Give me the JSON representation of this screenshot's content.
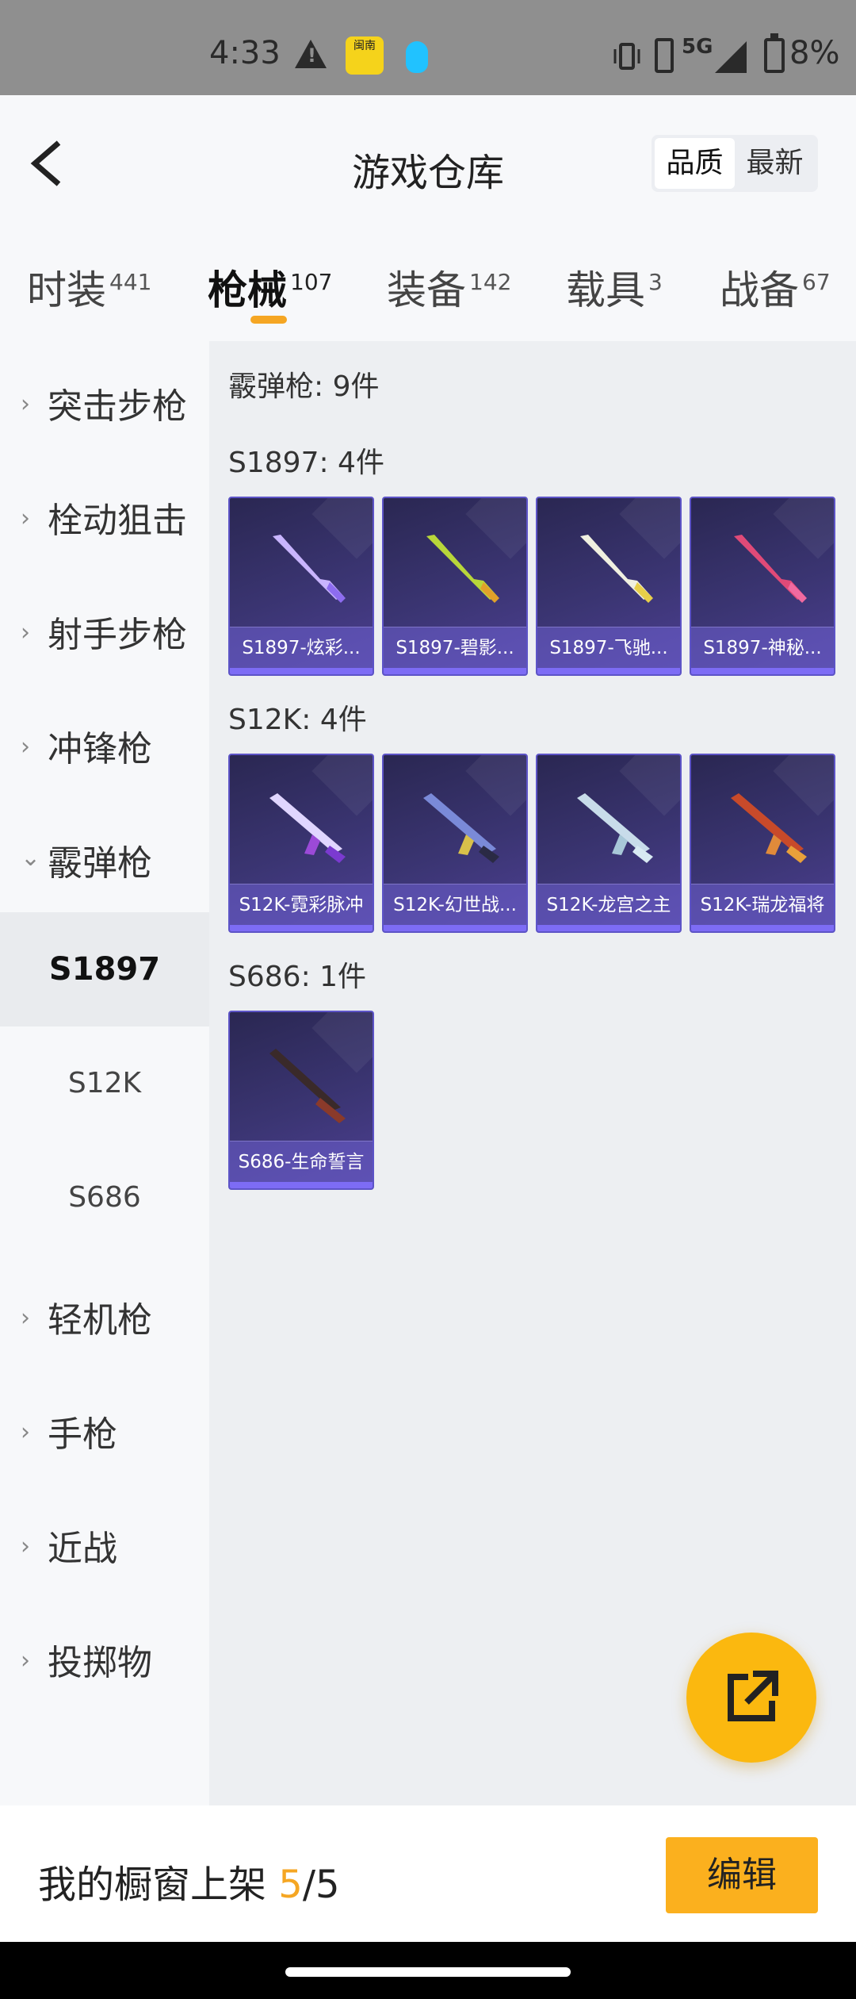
{
  "status_bar": {
    "time": "4:33",
    "network": "5G",
    "battery": "8%",
    "app_badge": "闽南"
  },
  "header": {
    "title": "游戏仓库",
    "sort_options": [
      "品质",
      "最新"
    ],
    "sort_selected": "品质"
  },
  "tabs": [
    {
      "label": "时装",
      "count": "441"
    },
    {
      "label": "枪械",
      "count": "107"
    },
    {
      "label": "装备",
      "count": "142"
    },
    {
      "label": "载具",
      "count": "3"
    },
    {
      "label": "战备",
      "count": "67"
    }
  ],
  "sidebar": {
    "items": [
      {
        "label": "突击步枪"
      },
      {
        "label": "栓动狙击"
      },
      {
        "label": "射手步枪"
      },
      {
        "label": "冲锋枪"
      },
      {
        "label": "霰弹枪"
      },
      {
        "label": "轻机枪"
      },
      {
        "label": "手枪"
      },
      {
        "label": "近战"
      },
      {
        "label": "投掷物"
      }
    ],
    "subitems": [
      {
        "label": "S1897"
      },
      {
        "label": "S12K"
      },
      {
        "label": "S686"
      }
    ]
  },
  "content": {
    "category_header": "霰弹枪: 9件",
    "sections": [
      {
        "title": "S1897: 4件",
        "items": [
          "S1897-炫彩...",
          "S1897-碧影...",
          "S1897-飞驰...",
          "S1897-神秘..."
        ]
      },
      {
        "title": "S12K: 4件",
        "items": [
          "S12K-霓彩脉冲",
          "S12K-幻世战...",
          "S12K-龙宫之主",
          "S12K-瑞龙福将"
        ]
      },
      {
        "title": "S686: 1件",
        "items": [
          "S686-生命誓言"
        ]
      }
    ]
  },
  "bottom": {
    "label_prefix": "我的橱窗上架 ",
    "used": "5",
    "sep": "/",
    "total": "5",
    "edit_label": "编辑"
  },
  "colors": {
    "accent": "#f5a623",
    "fab": "#fbb80f",
    "card_bg": "#3b3573",
    "card_border": "#5d54c7"
  },
  "icons": {
    "back": "chevron-left-icon",
    "fab": "share-external-icon"
  }
}
